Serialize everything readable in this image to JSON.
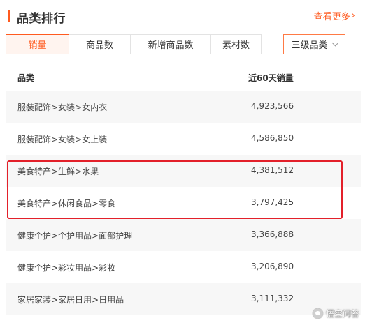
{
  "header": {
    "title": "品类排行",
    "more_label": "查看更多",
    "more_arrow": "›"
  },
  "tabs": [
    {
      "label": "销量",
      "active": true
    },
    {
      "label": "商品数",
      "active": false
    },
    {
      "label": "新增商品数",
      "active": false
    },
    {
      "label": "素材数",
      "active": false
    }
  ],
  "level_select": {
    "value": "三级品类"
  },
  "table": {
    "columns": [
      "品类",
      "近60天销量"
    ],
    "rows": [
      {
        "category": "服装配饰>女装>女内衣",
        "sales": "4,923,566"
      },
      {
        "category": "服装配饰>女装>女上装",
        "sales": "4,586,850"
      },
      {
        "category": "美食特产>生鲜>水果",
        "sales": "4,381,512"
      },
      {
        "category": "美食特产>休闲食品>零食",
        "sales": "3,797,425"
      },
      {
        "category": "健康个护>个护用品>面部护理",
        "sales": "3,366,888"
      },
      {
        "category": "健康个护>彩妆用品>彩妆",
        "sales": "3,206,890"
      },
      {
        "category": "家居家装>家居日用>日用品",
        "sales": "3,111,332"
      }
    ]
  },
  "highlight": {
    "rows": [
      2,
      3
    ],
    "color": "#e3202a"
  },
  "watermark": {
    "text": "悟空问答"
  },
  "colors": {
    "accent": "#ff5a1f",
    "row_shade": "#f7f7f7"
  }
}
